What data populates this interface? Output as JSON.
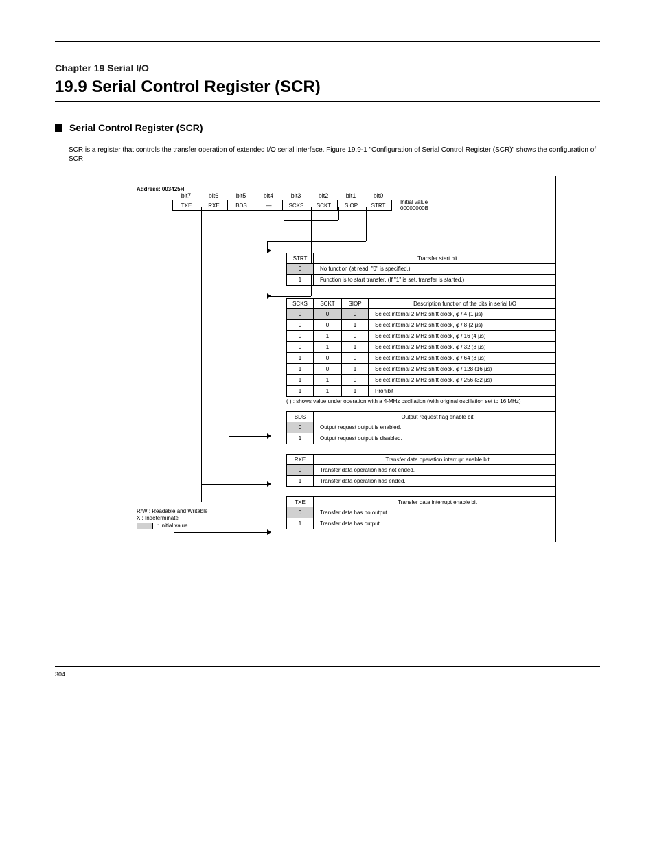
{
  "title": "19.9 Serial Control Register (SCR)",
  "chapter": "Chapter 19 Serial I/O",
  "section_title": "Serial Control Register (SCR)",
  "intro": "SCR is a register that controls the transfer operation of extended I/O serial interface. Figure 19.9-1 \"Configuration of Serial Control Register (SCR)\" shows the configuration of SCR.",
  "address_label": "Address: 003425H",
  "bit_labels": [
    "bit7",
    "bit6",
    "bit5",
    "bit4",
    "bit3",
    "bit2",
    "bit1",
    "bit0"
  ],
  "bit_names": [
    "TXE",
    "RXE",
    "BDS",
    "—",
    "SCKS",
    "SCKT",
    "SIOP",
    "STRT"
  ],
  "initial_label": "Initial value",
  "initial_value": "00000000B",
  "t1": {
    "header": [
      "STRT",
      "Transfer start bit"
    ],
    "rows": [
      [
        "0",
        "No function (at read, \"0\" is specified.)"
      ],
      [
        "1",
        "Function is to start transfer. (If \"1\" is set, transfer is started.)"
      ]
    ]
  },
  "t2": {
    "header": [
      "SCKS",
      "SCKT",
      "SIOP",
      "Description function of the bits in serial I/O"
    ],
    "rows": [
      [
        "0",
        "0",
        "0",
        "Select internal 2   MHz shift clock, φ / 4 (1   μs)"
      ],
      [
        "0",
        "0",
        "1",
        "Select internal 2   MHz shift clock, φ / 8 (2   μs)"
      ],
      [
        "0",
        "1",
        "0",
        "Select internal 2   MHz shift clock, φ / 16 (4   μs)"
      ],
      [
        "0",
        "1",
        "1",
        "Select internal 2   MHz shift clock, φ / 32 (8   μs)"
      ],
      [
        "1",
        "0",
        "0",
        "Select internal 2   MHz shift clock, φ / 64 (8   μs)"
      ],
      [
        "1",
        "0",
        "1",
        "Select internal 2   MHz shift clock, φ / 128 (16   μs)"
      ],
      [
        "1",
        "1",
        "0",
        "Select internal 2   MHz shift clock, φ / 256 (32   μs)"
      ],
      [
        "1",
        "1",
        "1",
        "Prohibit"
      ]
    ],
    "note": "( ) : shows value under operation with a 4-MHz oscillation (with original oscillation set to 16 MHz)"
  },
  "t3": {
    "header": [
      "BDS",
      "Output request flag enable bit"
    ],
    "rows": [
      [
        "0",
        "Output request output is enabled."
      ],
      [
        "1",
        "Output request output is disabled."
      ]
    ]
  },
  "t4": {
    "header": [
      "RXE",
      "Transfer data operation interrupt enable bit"
    ],
    "rows": [
      [
        "0",
        "Transfer data operation has not ended."
      ],
      [
        "1",
        "Transfer data operation has ended."
      ]
    ]
  },
  "t5": {
    "header": [
      "TXE",
      "Transfer data interrupt enable bit"
    ],
    "rows": [
      [
        "0",
        "Transfer data has no output"
      ],
      [
        "1",
        "Transfer data has output"
      ]
    ]
  },
  "legend_lines": [
    "R/W : Readable and Writable",
    "X     : Indeterminate"
  ],
  "legend_initial": ": Initial value",
  "footer_page": "304"
}
